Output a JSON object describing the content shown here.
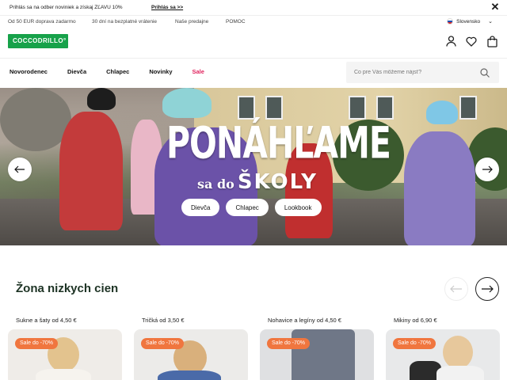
{
  "promo": {
    "text": "Prihlás sa na odber noviniek a získaj ZĽAVU 10%",
    "link": "Prihlás sa >>",
    "close": "✕"
  },
  "info": {
    "items": [
      "Od 50 EUR doprava zadarmo",
      "30 dní na bezplatné vrátenie",
      "Naše predajne",
      "POMOC"
    ],
    "language": "Slovensko"
  },
  "logo": "COCCODRILLO°",
  "nav": {
    "items": [
      "Novorodenec",
      "Dievča",
      "Chlapec",
      "Novinky",
      "Sale"
    ]
  },
  "search": {
    "placeholder": "Čo pre Vás môžeme nájsť?"
  },
  "hero": {
    "title": "PONÁHĽAME",
    "sub_small": "sa do",
    "sub_big": "ŠKOLY",
    "buttons": [
      "Dievča",
      "Chlapec",
      "Lookbook"
    ]
  },
  "section": {
    "title": "Žona nizkych cien",
    "cards": [
      {
        "label": "Sukne a šaty od 4,50 €",
        "badge": "Sale do -70%"
      },
      {
        "label": "Tričká od 3,50 €",
        "badge": "Sale do -70%"
      },
      {
        "label": "Nohavice a legíny od 4,50 €",
        "badge": "Sale do -70%"
      },
      {
        "label": "Mikiny od 6,90 €",
        "badge": "Sale do -70%"
      }
    ]
  },
  "colors": {
    "brand": "#17a24a",
    "sale": "#e0245e",
    "badge": "#f0763f"
  }
}
